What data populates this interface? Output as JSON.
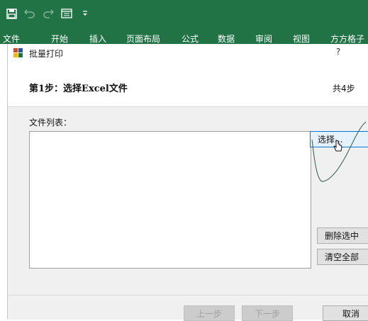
{
  "excel": {
    "ribbon_tabs": [
      "文件",
      "开始",
      "插入",
      "页面布局",
      "公式",
      "数据",
      "审阅",
      "视图",
      "方方格子"
    ],
    "accent_color": "#217346"
  },
  "qat": {
    "icons": [
      "save-icon",
      "undo-icon",
      "redo-icon",
      "form-icon",
      "customize-dropdown-icon"
    ]
  },
  "dialog": {
    "title": "批量打印",
    "help_label": "?",
    "step_title": "第1步：选择Excel文件",
    "step_total": "共4步",
    "file_list_label": "文件列表：",
    "buttons": {
      "select": "选择...",
      "delete_selected": "删除选中",
      "clear_all": "清空全部",
      "prev": "上一步",
      "next": "下一步",
      "cancel": "取消"
    }
  }
}
